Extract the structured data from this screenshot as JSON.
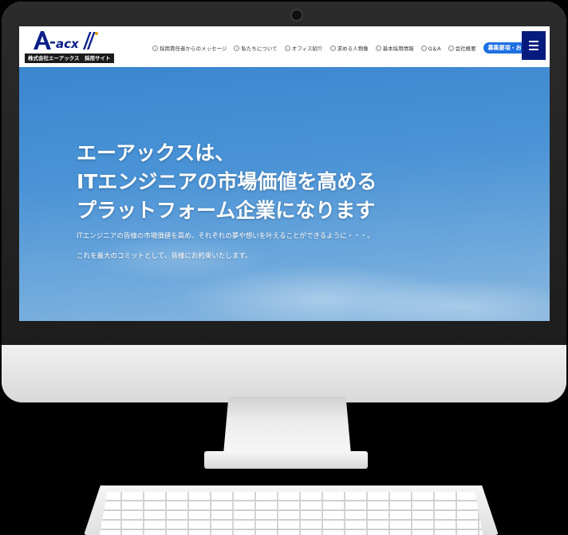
{
  "site": {
    "logo_alt": "A-acxl",
    "logo_sub": "株式会社エーアックス　採用サイト"
  },
  "nav": {
    "items": [
      {
        "label": "採用責任者からのメッセージ"
      },
      {
        "label": "私たちについて"
      },
      {
        "label": "オフィス紹介"
      },
      {
        "label": "求める人物像"
      },
      {
        "label": "基本採用情報"
      },
      {
        "label": "Q＆A"
      },
      {
        "label": "会社概要"
      }
    ],
    "cta_label": "募集要項・お問合せ"
  },
  "hero": {
    "title_lines": [
      "エーアックスは、",
      "ITエンジニアの市場価値を高める",
      "プラットフォーム企業になります"
    ],
    "sub_lines": [
      "ITエンジニアの皆様の市場価値を高め、それぞれの夢や想いを叶えることができるように・・・。",
      "これを最大のコミットとして、皆様にお約束いたします。"
    ]
  },
  "colors": {
    "brand_navy": "#061b7e",
    "cta_blue": "#1e6fe0",
    "sky": "#4a93d6"
  }
}
